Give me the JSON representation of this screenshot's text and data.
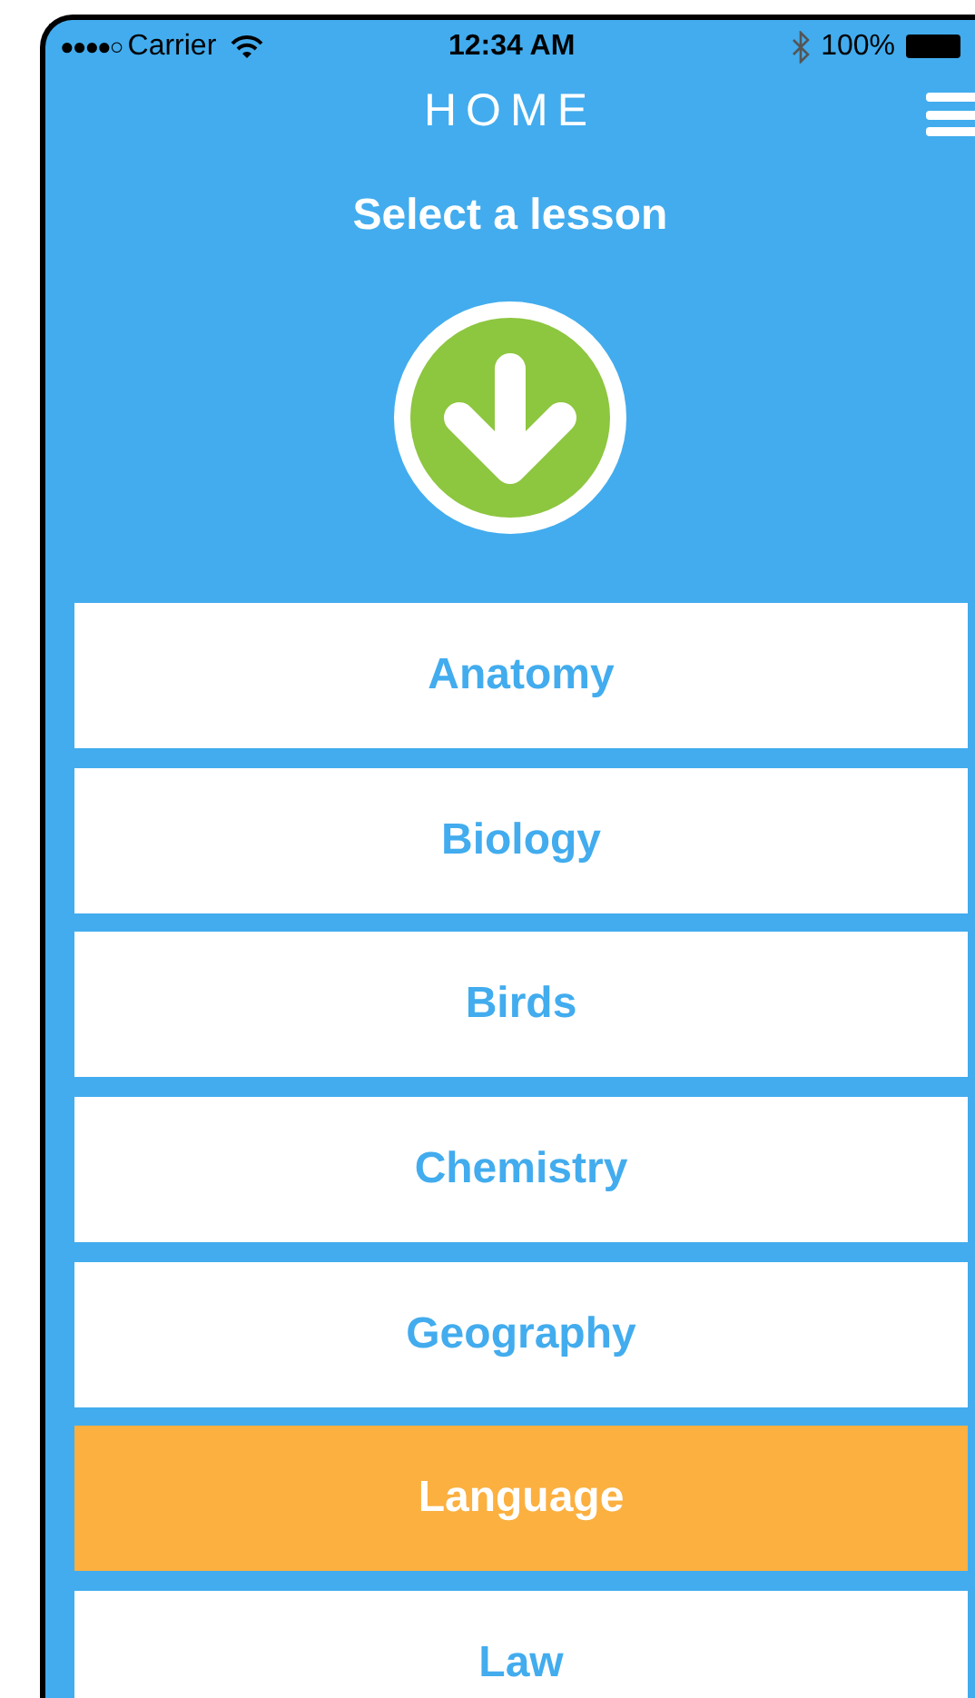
{
  "status_bar": {
    "signal_dots": "●●●●○",
    "carrier": "Carrier",
    "time": "12:34 AM",
    "battery": "100%"
  },
  "header": {
    "title": "HOME"
  },
  "prompt": "Select a lesson",
  "lessons": [
    {
      "label": "Anatomy",
      "selected": false
    },
    {
      "label": "Biology",
      "selected": false
    },
    {
      "label": "Birds",
      "selected": false
    },
    {
      "label": "Chemistry",
      "selected": false
    },
    {
      "label": "Geography",
      "selected": false
    },
    {
      "label": "Language",
      "selected": true
    },
    {
      "label": "Law",
      "selected": false
    }
  ]
}
